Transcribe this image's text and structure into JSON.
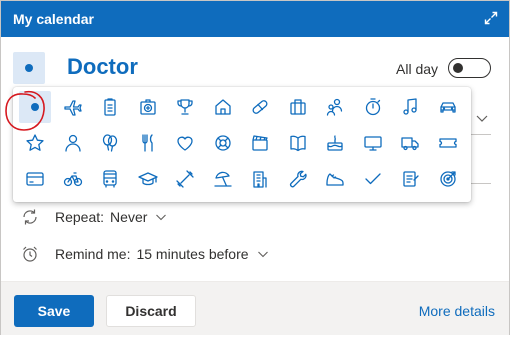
{
  "window": {
    "title": "My calendar"
  },
  "event": {
    "title": "Doctor",
    "all_day_label": "All day",
    "all_day_on": false
  },
  "category_picker": {
    "selected": "dot-icon",
    "rows": [
      [
        "dot-icon",
        "airplane-icon",
        "clipboard-icon",
        "first-aid-icon",
        "trophy-icon",
        "home-icon",
        "pill-icon",
        "briefcase-icon",
        "people-icon",
        "timer-icon",
        "music-note-icon",
        "car-icon"
      ],
      [
        "star-icon",
        "person-icon",
        "balloon-icon",
        "food-icon",
        "heart-icon",
        "lifebuoy-icon",
        "clapperboard-icon",
        "book-icon",
        "cake-icon",
        "monitor-icon",
        "truck-icon",
        "ticket-icon"
      ],
      [
        "credit-card-icon",
        "bicycle-icon",
        "bus-icon",
        "graduation-cap-icon",
        "dumbbell-icon",
        "beach-icon",
        "building-icon",
        "wrench-icon",
        "sneaker-icon",
        "checkmark-icon",
        "notepad-icon",
        "target-icon"
      ]
    ]
  },
  "repeat": {
    "label": "Repeat:",
    "value": "Never"
  },
  "reminder": {
    "label": "Remind me:",
    "value": "15 minutes before"
  },
  "footer": {
    "save_label": "Save",
    "discard_label": "Discard",
    "more_details_label": "More details"
  },
  "colors": {
    "accent": "#0f6cbd",
    "annotation": "#d6181f",
    "selected_bg": "#dce8f6"
  }
}
